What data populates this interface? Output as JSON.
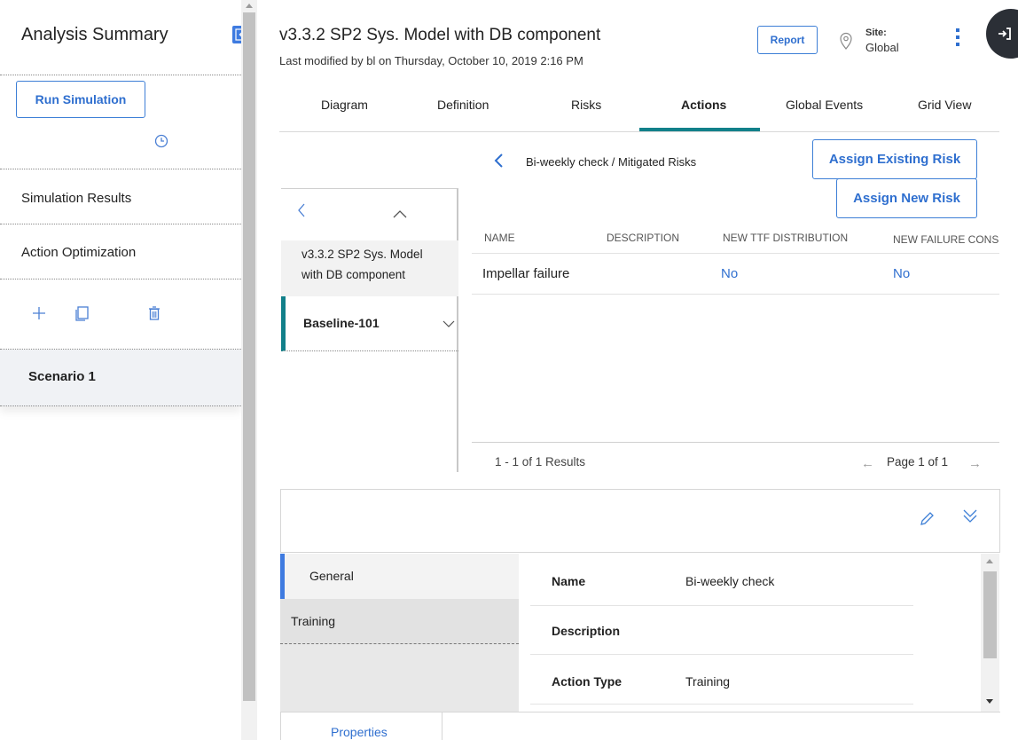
{
  "left_panel": {
    "title": "Analysis Summary",
    "run_simulation": "Run Simulation",
    "items": [
      "Simulation Results",
      "Action Optimization"
    ],
    "scenario": "Scenario 1"
  },
  "header": {
    "title": "v3.3.2 SP2 Sys. Model with DB component",
    "subtitle": "Last modified by bl on Thursday, October 10, 2019 2:16 PM",
    "report": "Report",
    "site_label": "Site:",
    "site_value": "Global"
  },
  "tabs": [
    "Diagram",
    "Definition",
    "Risks",
    "Actions",
    "Global Events",
    "Grid View"
  ],
  "active_tab": "Actions",
  "breadcrumb": "Bi-weekly check / Mitigated Risks",
  "buttons": {
    "assign_existing": "Assign Existing Risk",
    "assign_new": "Assign New Risk"
  },
  "tree": {
    "model": "v3.3.2 SP2 Sys. Model with DB component",
    "model_line1": "v3.3.2 SP2 Sys. Model",
    "model_line2": "with DB component",
    "baseline": "Baseline-101"
  },
  "table": {
    "columns": [
      "NAME",
      "DESCRIPTION",
      "NEW TTF DISTRIBUTION",
      "NEW FAILURE CONS"
    ],
    "rows": [
      {
        "name": "Impellar failure",
        "description": "",
        "ttf": "No",
        "failure": "No"
      }
    ],
    "results": "1 - 1 of 1 Results",
    "page": "Page 1 of 1"
  },
  "details": {
    "side_tabs": [
      "General",
      "Training"
    ],
    "fields": [
      {
        "label": "Name",
        "value": "Bi-weekly check"
      },
      {
        "label": "Description",
        "value": ""
      },
      {
        "label": "Action Type",
        "value": "Training"
      }
    ],
    "bottom_tab": "Properties"
  },
  "colors": {
    "accent": "#2f6fcf",
    "active_tab_underline": "#12808a",
    "baseline_marker": "#12808a",
    "general_marker": "#3f7be0"
  }
}
